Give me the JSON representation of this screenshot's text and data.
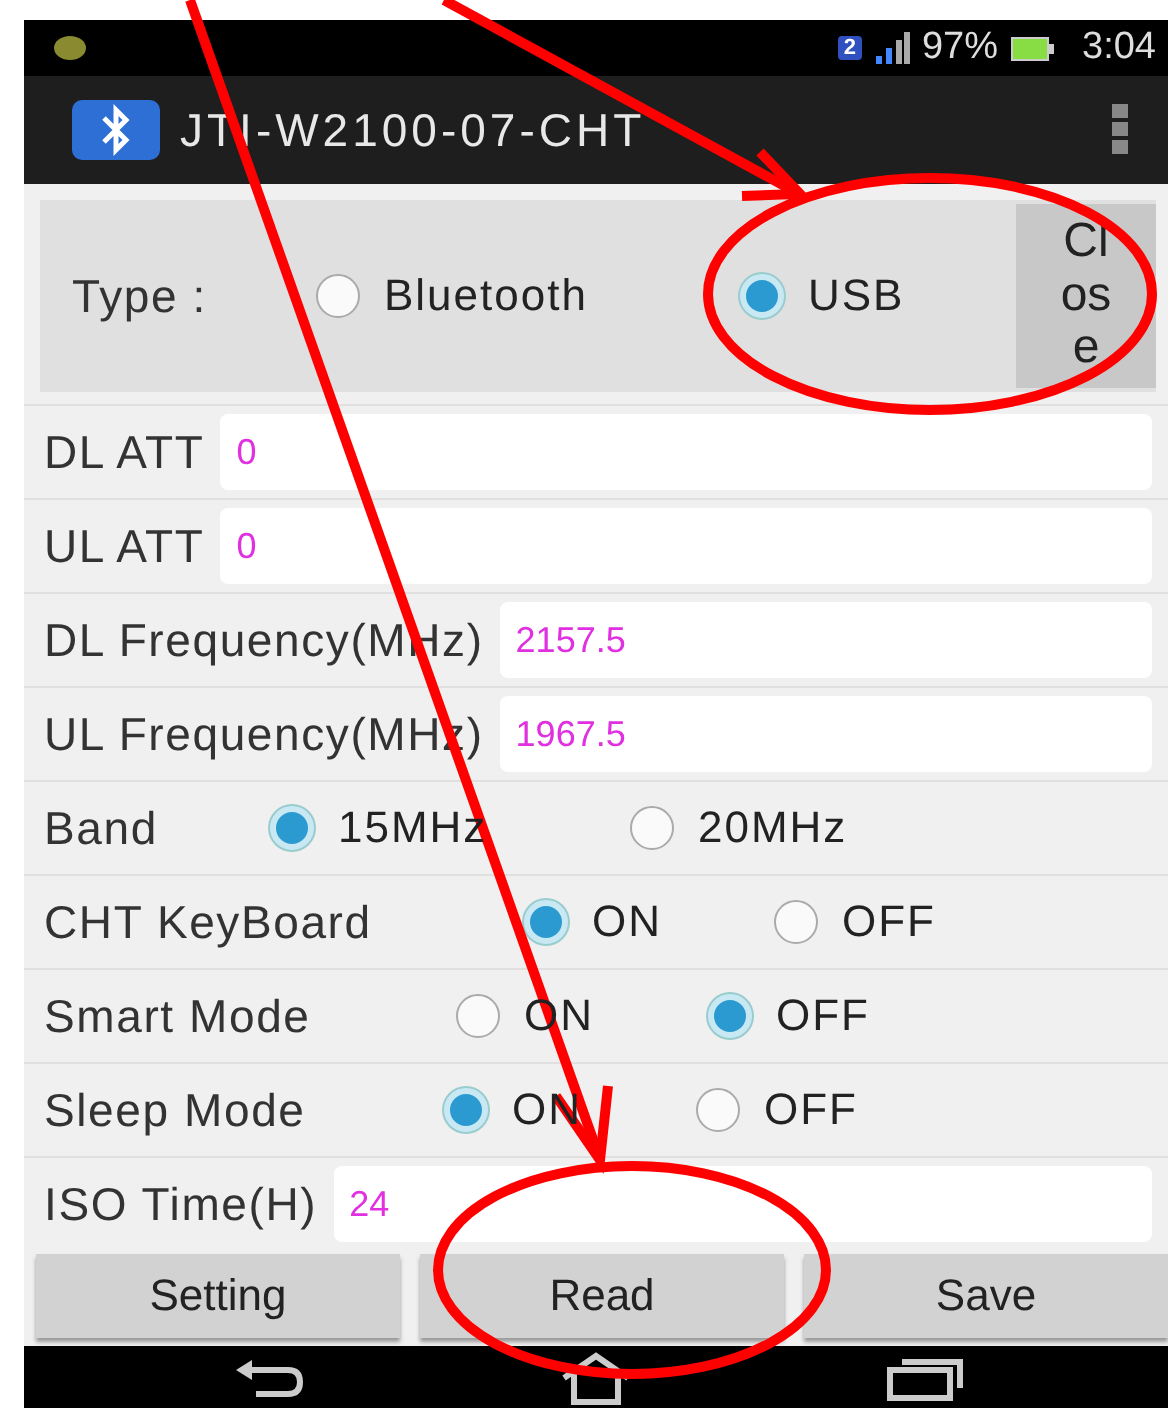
{
  "status_bar": {
    "sim": "2",
    "battery": "97%",
    "time": "3:04"
  },
  "app_bar": {
    "title": "JTI-W2100-07-CHT"
  },
  "type_panel": {
    "label": "Type :",
    "options": [
      {
        "label": "Bluetooth",
        "selected": false
      },
      {
        "label": "USB",
        "selected": true
      }
    ],
    "close_button": "Close"
  },
  "rows": [
    {
      "kind": "field",
      "label": "DL ATT",
      "value": "0"
    },
    {
      "kind": "field",
      "label": "UL ATT",
      "value": "0"
    },
    {
      "kind": "field",
      "label": "DL Frequency(MHz)",
      "value": "2157.5"
    },
    {
      "kind": "field",
      "label": "UL Frequency(MHz)",
      "value": "1967.5"
    },
    {
      "kind": "radio",
      "label": "Band",
      "options": [
        {
          "label": "15MHz",
          "selected": true
        },
        {
          "label": "20MHz",
          "selected": false
        }
      ]
    },
    {
      "kind": "radio",
      "label": "CHT KeyBoard",
      "options": [
        {
          "label": "ON",
          "selected": true
        },
        {
          "label": "OFF",
          "selected": false
        }
      ]
    },
    {
      "kind": "radio",
      "label": "Smart Mode",
      "options": [
        {
          "label": "ON",
          "selected": false
        },
        {
          "label": "OFF",
          "selected": true
        }
      ]
    },
    {
      "kind": "radio",
      "label": "Sleep Mode",
      "options": [
        {
          "label": "ON",
          "selected": true
        },
        {
          "label": "OFF",
          "selected": false
        }
      ]
    },
    {
      "kind": "field",
      "label": "ISO Time(H)",
      "value": "24"
    }
  ],
  "buttons": [
    "Setting",
    "Read",
    "Save"
  ]
}
